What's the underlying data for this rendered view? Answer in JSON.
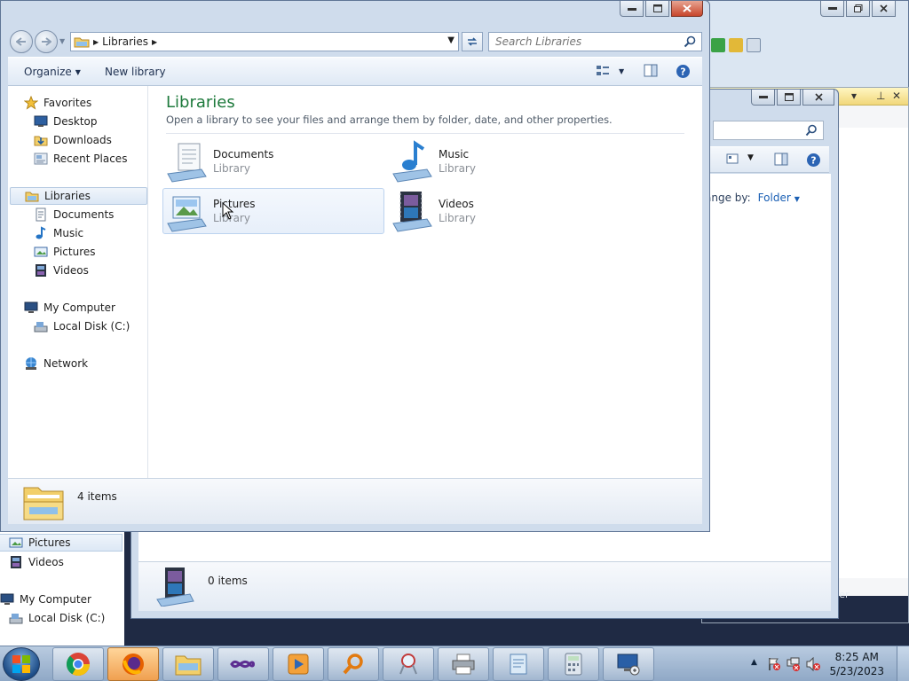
{
  "colors": {
    "title_green": "#1e7a3c",
    "selection_bg": "#dbe7f5",
    "taskbar": "#8fa8c6"
  },
  "front_window": {
    "address": {
      "crumb": "Libraries"
    },
    "search": {
      "placeholder": "Search Libraries"
    },
    "toolbar": {
      "organize": "Organize",
      "new_library": "New library"
    },
    "nav": {
      "favorites": "Favorites",
      "desktop": "Desktop",
      "downloads": "Downloads",
      "recent_places": "Recent Places",
      "libraries": "Libraries",
      "documents": "Documents",
      "music": "Music",
      "pictures": "Pictures",
      "videos": "Videos",
      "my_computer": "My Computer",
      "local_disk": "Local Disk (C:)",
      "network": "Network"
    },
    "main": {
      "title": "Libraries",
      "subtitle": "Open a library to see your files and arrange them by folder, date, and other properties.",
      "items": [
        {
          "name": "Documents",
          "type": "Library",
          "icon": "documents-library-icon"
        },
        {
          "name": "Music",
          "type": "Library",
          "icon": "music-library-icon"
        },
        {
          "name": "Pictures",
          "type": "Library",
          "icon": "pictures-library-icon"
        },
        {
          "name": "Videos",
          "type": "Library",
          "icon": "videos-library-icon"
        }
      ]
    },
    "status": {
      "count": "4 items"
    }
  },
  "mid_window": {
    "arrange_label": "ange by:",
    "arrange_value": "Folder",
    "status": {
      "count": "0 items"
    },
    "nav": {
      "pictures": "Pictures",
      "videos": "Videos",
      "my_computer": "My Computer",
      "local_disk": "Local Disk (C:)"
    }
  },
  "bg_window": {
    "partial_text": "rer"
  },
  "taskbar": {
    "time": "8:25 AM",
    "date": "5/23/2023",
    "apps": [
      "chrome-icon",
      "firefox-icon",
      "explorer-icon",
      "visual-studio-icon",
      "media-player-icon",
      "search-magnifier-icon",
      "snipping-tool-icon",
      "printer-icon",
      "notepad-icon",
      "calculator-icon",
      "remote-desktop-icon"
    ]
  }
}
